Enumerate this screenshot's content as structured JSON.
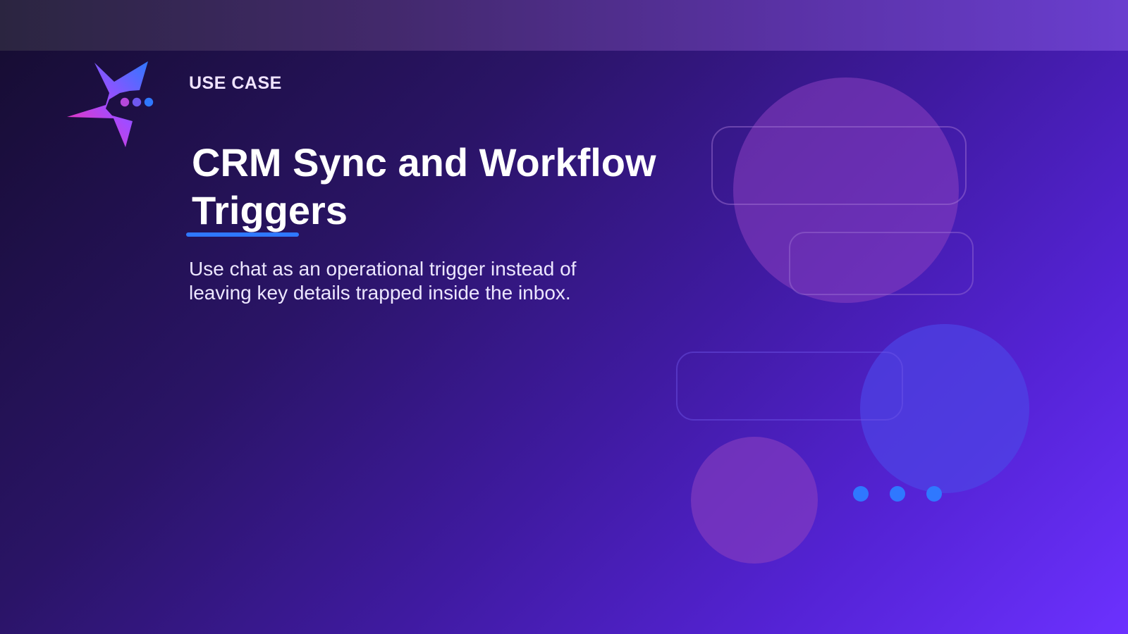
{
  "slide": {
    "eyebrow": "USE CASE",
    "title": "CRM Sync and Workflow Triggers",
    "subtitle": "Use chat as an operational trigger instead of leaving key details trapped inside the inbox."
  },
  "colors": {
    "accent": "#2f78ff",
    "title_text": "#ffffff",
    "subtitle_text": "#ece6ff",
    "eyebrow_text": "#efe3ff"
  },
  "icons": {
    "logo": "star-chat-logo-icon",
    "decor_dots": "typing-dots-icon"
  }
}
